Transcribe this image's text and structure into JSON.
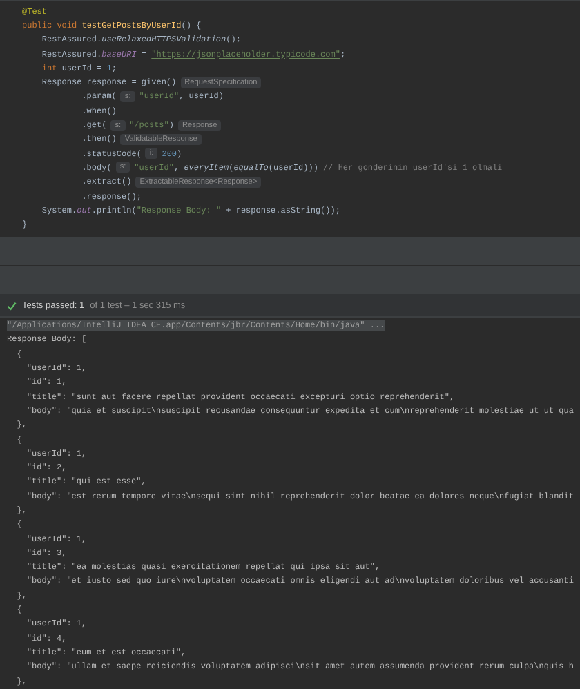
{
  "editor": {
    "lines": [
      [
        {
          "kind": "annotation",
          "text": "@Test"
        }
      ],
      [
        {
          "kind": "keyword",
          "text": "public void "
        },
        {
          "kind": "method",
          "text": "testGetPostsByUserId"
        },
        {
          "kind": "plain",
          "text": "() {"
        }
      ],
      [
        {
          "kind": "plain",
          "text": "    RestAssured."
        },
        {
          "kind": "static",
          "text": "useRelaxedHTTPSValidation"
        },
        {
          "kind": "plain",
          "text": "();"
        }
      ],
      [
        {
          "kind": "plain",
          "text": "    RestAssured."
        },
        {
          "kind": "field",
          "text": "baseURI"
        },
        {
          "kind": "plain",
          "text": " = "
        },
        {
          "kind": "url",
          "text": "\"https://jsonplaceholder.typicode.com\""
        },
        {
          "kind": "plain",
          "text": ";"
        }
      ],
      [
        {
          "kind": "keyword",
          "text": "    int "
        },
        {
          "kind": "plain",
          "text": "userId = "
        },
        {
          "kind": "number",
          "text": "1"
        },
        {
          "kind": "plain",
          "text": ";"
        }
      ],
      [
        {
          "kind": "plain",
          "text": "    Response response = given()"
        },
        {
          "kind": "hint",
          "text": "RequestSpecification"
        }
      ],
      [
        {
          "kind": "plain",
          "text": "            .param("
        },
        {
          "kind": "hint",
          "text": "s:"
        },
        {
          "kind": "string",
          "text": "\"userId\""
        },
        {
          "kind": "plain",
          "text": ", userId)"
        }
      ],
      [
        {
          "kind": "plain",
          "text": "            .when()"
        }
      ],
      [
        {
          "kind": "plain",
          "text": "            .get("
        },
        {
          "kind": "hint",
          "text": "s:"
        },
        {
          "kind": "string",
          "text": "\"/posts\""
        },
        {
          "kind": "plain",
          "text": ")"
        },
        {
          "kind": "hint",
          "text": "Response"
        }
      ],
      [
        {
          "kind": "plain",
          "text": "            .then()"
        },
        {
          "kind": "hint",
          "text": "ValidatableResponse"
        }
      ],
      [
        {
          "kind": "plain",
          "text": "            .statusCode("
        },
        {
          "kind": "hint",
          "text": "i:"
        },
        {
          "kind": "number",
          "text": "200"
        },
        {
          "kind": "plain",
          "text": ")"
        }
      ],
      [
        {
          "kind": "plain",
          "text": "            .body("
        },
        {
          "kind": "hint",
          "text": "s:"
        },
        {
          "kind": "string",
          "text": "\"userId\""
        },
        {
          "kind": "plain",
          "text": ", "
        },
        {
          "kind": "static",
          "text": "everyItem"
        },
        {
          "kind": "plain",
          "text": "("
        },
        {
          "kind": "static",
          "text": "equalTo"
        },
        {
          "kind": "plain",
          "text": "(userId))) "
        },
        {
          "kind": "comment",
          "text": "// Her gonderinin userId'si 1 olmali"
        }
      ],
      [
        {
          "kind": "plain",
          "text": "            .extract()"
        },
        {
          "kind": "hint",
          "text": "ExtractableResponse<Response>"
        }
      ],
      [
        {
          "kind": "plain",
          "text": "            .response();"
        }
      ],
      [
        {
          "kind": "plain",
          "text": "    System."
        },
        {
          "kind": "field",
          "text": "out"
        },
        {
          "kind": "plain",
          "text": ".println("
        },
        {
          "kind": "string",
          "text": "\"Response Body: \""
        },
        {
          "kind": "plain",
          "text": " + response.asString());"
        }
      ],
      [
        {
          "kind": "plain",
          "text": "}"
        }
      ]
    ]
  },
  "test_status": {
    "passed": true,
    "label": "Tests passed: 1",
    "detail": "of 1 test – 1 sec 315 ms"
  },
  "console": {
    "lines": [
      {
        "kind": "command",
        "text": "\"/Applications/IntelliJ IDEA CE.app/Contents/jbr/Contents/Home/bin/java\" ..."
      },
      {
        "kind": "output",
        "text": "Response Body: ["
      },
      {
        "kind": "output",
        "text": "  {"
      },
      {
        "kind": "output",
        "text": "    \"userId\": 1,"
      },
      {
        "kind": "output",
        "text": "    \"id\": 1,"
      },
      {
        "kind": "output",
        "text": "    \"title\": \"sunt aut facere repellat provident occaecati excepturi optio reprehenderit\","
      },
      {
        "kind": "output",
        "text": "    \"body\": \"quia et suscipit\\nsuscipit recusandae consequuntur expedita et cum\\nreprehenderit molestiae ut ut qua"
      },
      {
        "kind": "output",
        "text": "  },"
      },
      {
        "kind": "output",
        "text": "  {"
      },
      {
        "kind": "output",
        "text": "    \"userId\": 1,"
      },
      {
        "kind": "output",
        "text": "    \"id\": 2,"
      },
      {
        "kind": "output",
        "text": "    \"title\": \"qui est esse\","
      },
      {
        "kind": "output",
        "text": "    \"body\": \"est rerum tempore vitae\\nsequi sint nihil reprehenderit dolor beatae ea dolores neque\\nfugiat blandit"
      },
      {
        "kind": "output",
        "text": "  },"
      },
      {
        "kind": "output",
        "text": "  {"
      },
      {
        "kind": "output",
        "text": "    \"userId\": 1,"
      },
      {
        "kind": "output",
        "text": "    \"id\": 3,"
      },
      {
        "kind": "output",
        "text": "    \"title\": \"ea molestias quasi exercitationem repellat qui ipsa sit aut\","
      },
      {
        "kind": "output",
        "text": "    \"body\": \"et iusto sed quo iure\\nvoluptatem occaecati omnis eligendi aut ad\\nvoluptatem doloribus vel accusanti"
      },
      {
        "kind": "output",
        "text": "  },"
      },
      {
        "kind": "output",
        "text": "  {"
      },
      {
        "kind": "output",
        "text": "    \"userId\": 1,"
      },
      {
        "kind": "output",
        "text": "    \"id\": 4,"
      },
      {
        "kind": "output",
        "text": "    \"title\": \"eum et est occaecati\","
      },
      {
        "kind": "output",
        "text": "    \"body\": \"ullam et saepe reiciendis voluptatem adipisci\\nsit amet autem assumenda provident rerum culpa\\nquis h"
      },
      {
        "kind": "output",
        "text": "  },"
      }
    ]
  }
}
